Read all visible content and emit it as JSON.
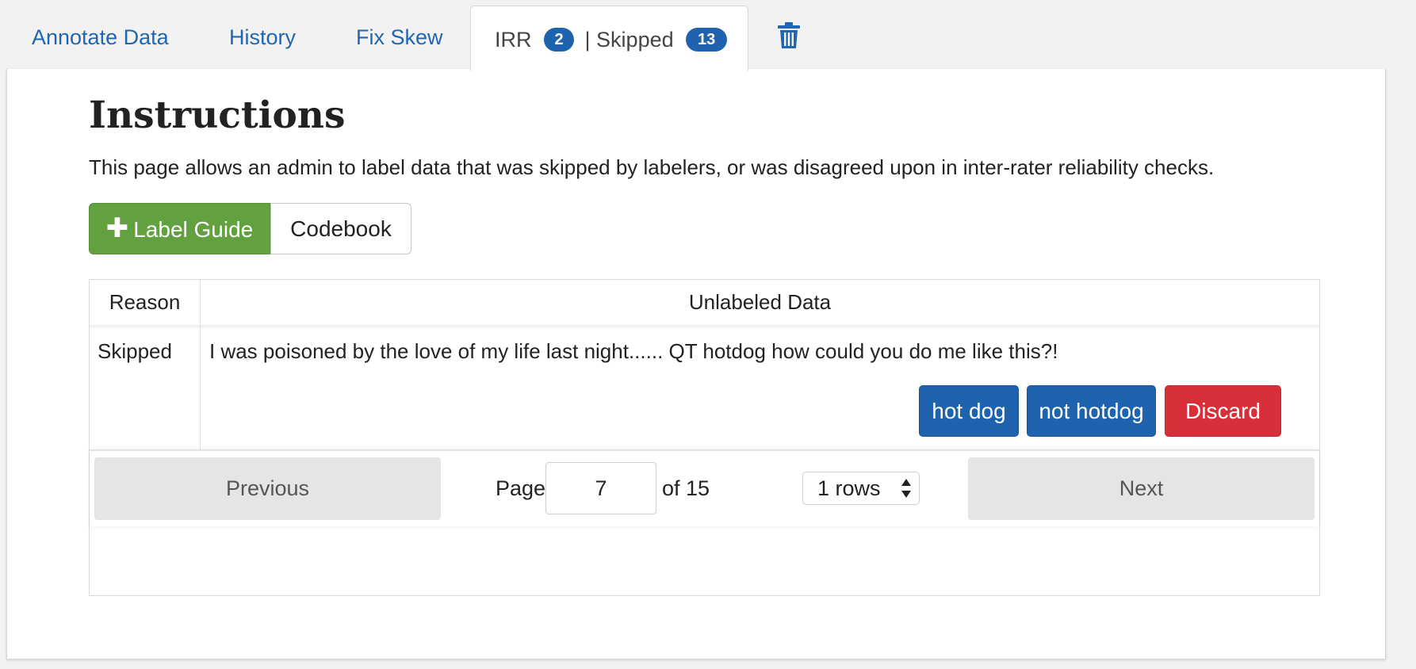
{
  "tabs": {
    "annotate": "Annotate Data",
    "history": "History",
    "fix_skew": "Fix Skew",
    "active": {
      "irr_label": "IRR",
      "irr_count": "2",
      "separator": "| Skipped",
      "skipped_count": "13"
    },
    "trash_icon": "trash-icon"
  },
  "instructions": {
    "title": "Instructions",
    "description": "This page allows an admin to label data that was skipped by labelers, or was disagreed upon in inter-rater reliability checks."
  },
  "buttons": {
    "label_guide": "Label Guide",
    "codebook": "Codebook"
  },
  "table": {
    "headers": [
      "Reason",
      "Unlabeled Data"
    ],
    "rows": [
      {
        "reason": "Skipped",
        "data": "I was poisoned by the love of my life last night...... QT hotdog how could you do me like this?!",
        "actions": [
          "hot dog",
          "not hotdog",
          "Discard"
        ]
      }
    ]
  },
  "pagination": {
    "previous": "Previous",
    "page_label": "Page",
    "page_value": "7",
    "of_label": "of 15",
    "rows_value": "1 rows",
    "next": "Next"
  },
  "colors": {
    "link_blue": "#2166b0",
    "badge_blue": "#1f63ae",
    "green": "#63a040",
    "red": "#d8303a"
  }
}
